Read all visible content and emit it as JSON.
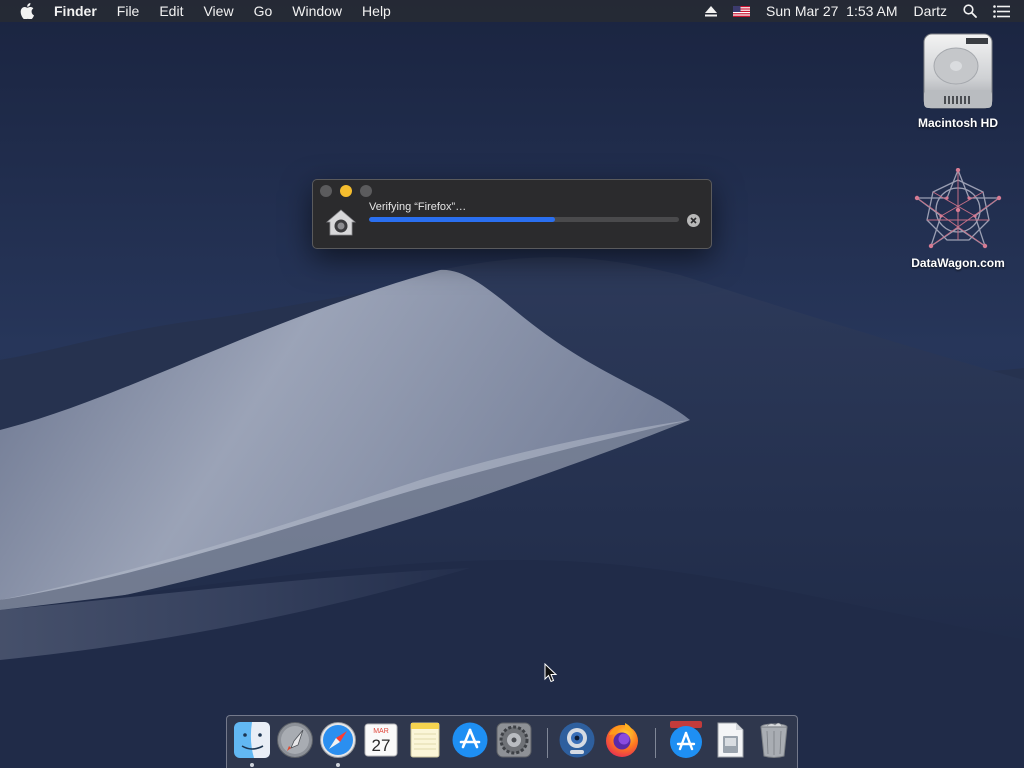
{
  "menubar": {
    "apple_icon": "apple-logo-icon",
    "items": [
      "Finder",
      "File",
      "Edit",
      "View",
      "Go",
      "Window",
      "Help"
    ],
    "status": {
      "eject_icon": "eject-icon",
      "flag_icon": "us-flag-input-icon",
      "datetime": "Sun Mar 27  1:53 AM",
      "user": "Dartz",
      "spotlight_icon": "spotlight-search-icon",
      "notification_icon": "notification-center-icon"
    }
  },
  "desktop": {
    "icons": [
      {
        "label": "Macintosh HD",
        "icon": "hard-drive-icon"
      },
      {
        "label": "DataWagon.com",
        "icon": "geometric-star-icon"
      }
    ]
  },
  "dialog": {
    "title": "Verifying “Firefox”…",
    "progress_fraction": 0.6,
    "icon": "gatekeeper-house-icon",
    "cancel_icon": "cancel-icon"
  },
  "dock": {
    "items": [
      {
        "name": "finder",
        "icon": "finder-icon",
        "running": true
      },
      {
        "name": "launchpad",
        "icon": "launchpad-icon",
        "running": false
      },
      {
        "name": "safari",
        "icon": "safari-icon",
        "running": true
      },
      {
        "name": "calendar",
        "icon": "calendar-icon",
        "running": false,
        "month": "MAR",
        "day": "27"
      },
      {
        "name": "notes",
        "icon": "notes-icon",
        "running": false
      },
      {
        "name": "app-store",
        "icon": "app-store-icon",
        "running": false
      },
      {
        "name": "system-preferences",
        "icon": "system-preferences-icon",
        "running": false
      },
      {
        "name": "screen-recorder",
        "icon": "webcam-icon",
        "running": false
      },
      {
        "name": "firefox",
        "icon": "firefox-icon",
        "running": false
      },
      {
        "name": "app-store-download",
        "icon": "app-store-download-icon",
        "running": false
      },
      {
        "name": "preview",
        "icon": "preview-icon",
        "running": false
      },
      {
        "name": "trash",
        "icon": "trash-icon",
        "running": false
      }
    ]
  },
  "colors": {
    "sky": "#1d2945",
    "dune_light": "#9aa3b7",
    "dune_shadow": "#3a4662",
    "accent_progress": "#2a6ff0",
    "minimize": "#f5bd2e"
  }
}
